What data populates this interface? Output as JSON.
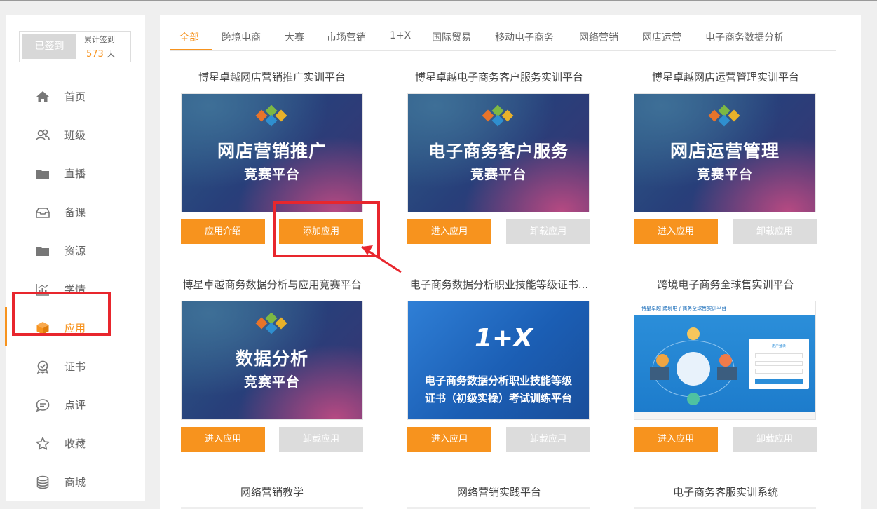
{
  "checkin": {
    "button": "已签到",
    "cumulative_label": "累计签到",
    "days": "573",
    "days_unit": "天"
  },
  "sidebar": {
    "items": [
      {
        "label": "首页",
        "icon": "home-icon"
      },
      {
        "label": "班级",
        "icon": "class-icon"
      },
      {
        "label": "直播",
        "icon": "folder-icon"
      },
      {
        "label": "备课",
        "icon": "inbox-icon"
      },
      {
        "label": "资源",
        "icon": "folder-icon"
      },
      {
        "label": "学情",
        "icon": "chart-icon"
      },
      {
        "label": "应用",
        "icon": "cube-icon",
        "active": true
      },
      {
        "label": "证书",
        "icon": "badge-icon"
      },
      {
        "label": "点评",
        "icon": "comment-icon"
      },
      {
        "label": "收藏",
        "icon": "star-icon"
      },
      {
        "label": "商城",
        "icon": "database-icon"
      }
    ]
  },
  "tabs": [
    "全部",
    "跨境电商",
    "大赛",
    "市场营销",
    "1+X",
    "国际贸易",
    "移动电子商务",
    "网络营销",
    "网店运营",
    "电子商务数据分析"
  ],
  "cards": [
    {
      "title": "博星卓越网店营销推广实训平台",
      "banner_big": "网店营销推广",
      "banner_small": "竞赛平台",
      "btn1": "应用介绍",
      "btn2": "添加应用",
      "btn2_style": "orange"
    },
    {
      "title": "博星卓越电子商务客户服务实训平台",
      "banner_big": "电子商务客户服务",
      "banner_small": "竞赛平台",
      "btn1": "进入应用",
      "btn2": "卸载应用",
      "btn2_style": "gray"
    },
    {
      "title": "博星卓越网店运营管理实训平台",
      "banner_big": "网店运营管理",
      "banner_small": "竞赛平台",
      "btn1": "进入应用",
      "btn2": "卸载应用",
      "btn2_style": "gray"
    },
    {
      "title": "博星卓越商务数据分析与应用竞赛平台",
      "banner_big": "数据分析",
      "banner_small": "竞赛平台",
      "btn1": "进入应用",
      "btn2": "卸载应用",
      "btn2_style": "gray"
    },
    {
      "title": "电子商务数据分析职业技能等级证书...",
      "banner_mark": "1+X",
      "banner_l1": "电子商务数据分析职业技能等级",
      "banner_l2": "证书（初级实操）考试训练平台",
      "btn1": "进入应用",
      "btn2": "卸载应用",
      "btn2_style": "gray"
    },
    {
      "title": "跨境电子商务全球售实训平台",
      "shot_header": "博星卓越 跨境电子商务全球售实训平台",
      "shot_login": "用户登录",
      "btn1": "进入应用",
      "btn2": "卸载应用",
      "btn2_style": "gray"
    }
  ],
  "bottom_titles": [
    "网络营销教学",
    "网络营销实践平台",
    "电子商务客服实训系统"
  ],
  "colors": {
    "accent": "#f7931e",
    "disabled": "#dcdcdc",
    "highlight": "#e8262d"
  }
}
